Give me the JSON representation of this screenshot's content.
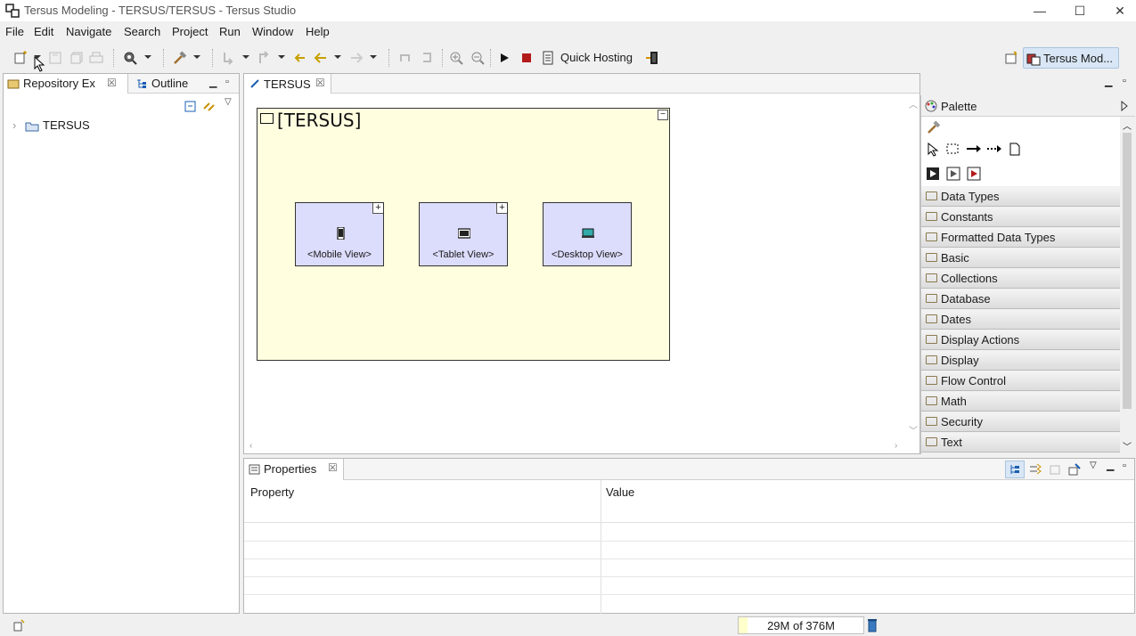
{
  "window": {
    "title": "Tersus Modeling - TERSUS/TERSUS - Tersus Studio",
    "minimize_glyph": "—",
    "maximize_glyph": "☐",
    "close_glyph": "✕"
  },
  "menubar": {
    "items": [
      "File",
      "Edit",
      "Navigate",
      "Search",
      "Project",
      "Run",
      "Window",
      "Help"
    ]
  },
  "toolbar": {
    "quick_hosting_label": "Quick Hosting",
    "perspective_label": "Tersus Mod..."
  },
  "left_panel": {
    "tabs": [
      {
        "label": "Repository Ex",
        "close": "☒"
      },
      {
        "label": "Outline"
      }
    ],
    "tree": [
      {
        "label": "TERSUS",
        "expander": "›"
      }
    ]
  },
  "editor": {
    "tab_label": "TERSUS",
    "tab_close": "☒",
    "root": {
      "title": "[TERSUS]",
      "collapse_glyph": "−"
    },
    "views": [
      {
        "label": "<Mobile View>",
        "icon": "mobile-icon",
        "expand": "+"
      },
      {
        "label": "<Tablet View>",
        "icon": "tablet-icon",
        "expand": "+"
      },
      {
        "label": "<Desktop View>",
        "icon": "desktop-icon",
        "expand": ""
      }
    ]
  },
  "palette": {
    "title": "Palette",
    "drawers": [
      "Data Types",
      "Constants",
      "Formatted Data Types",
      "Basic",
      "Collections",
      "Database",
      "Dates",
      "Display Actions",
      "Display",
      "Flow Control",
      "Math",
      "Security",
      "Text"
    ]
  },
  "properties": {
    "tab_label": "Properties",
    "tab_close": "☒",
    "columns": [
      "Property",
      "Value"
    ]
  },
  "status": {
    "heap": "29M of 376M"
  },
  "colors": {
    "canvas_root_bg": "#ffffe0",
    "view_box_bg": "#dcdcfc",
    "accent": "#d8e6f5"
  }
}
